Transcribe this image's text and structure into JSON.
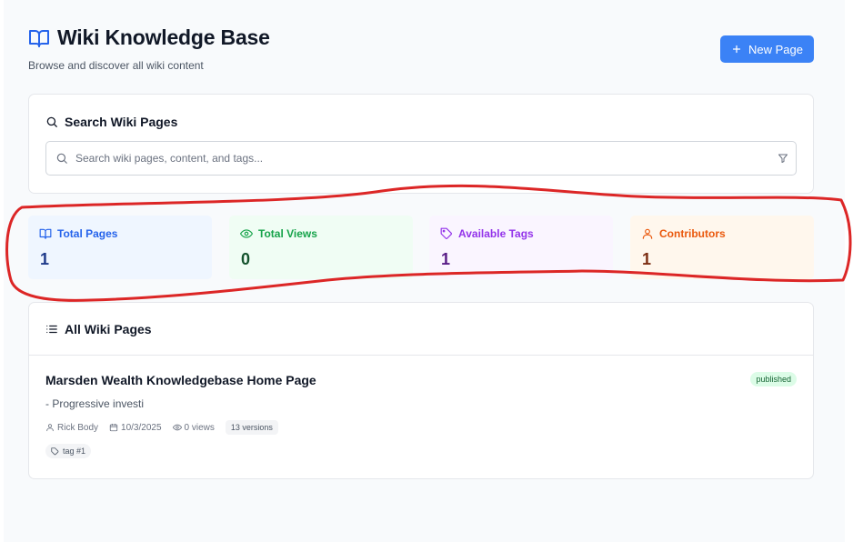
{
  "header": {
    "title": "Wiki Knowledge Base",
    "subtitle": "Browse and discover all wiki content",
    "new_page_label": "New Page",
    "title_icon": "book-open-icon"
  },
  "search": {
    "title": "Search Wiki Pages",
    "placeholder": "Search wiki pages, content, and tags...",
    "value": ""
  },
  "stats": [
    {
      "label": "Total Pages",
      "value": "1",
      "icon": "book-icon",
      "color": "#2563eb"
    },
    {
      "label": "Total Views",
      "value": "0",
      "icon": "eye-icon",
      "color": "#16a34a"
    },
    {
      "label": "Available Tags",
      "value": "1",
      "icon": "tag-icon",
      "color": "#9333ea"
    },
    {
      "label": "Contributors",
      "value": "1",
      "icon": "user-icon",
      "color": "#ea580c"
    }
  ],
  "pages": {
    "title": "All Wiki Pages",
    "items": [
      {
        "title": "Marsden Wealth Knowledgebase Home Page",
        "status": "published",
        "excerpt": "- Progressive investi",
        "author": "Rick Body",
        "date": "10/3/2025",
        "views": "0 views",
        "versions": "13 versions",
        "tags": [
          "tag #1"
        ]
      }
    ]
  },
  "colors": {
    "accent": "#3b82f6",
    "annotation": "#dc2626"
  }
}
